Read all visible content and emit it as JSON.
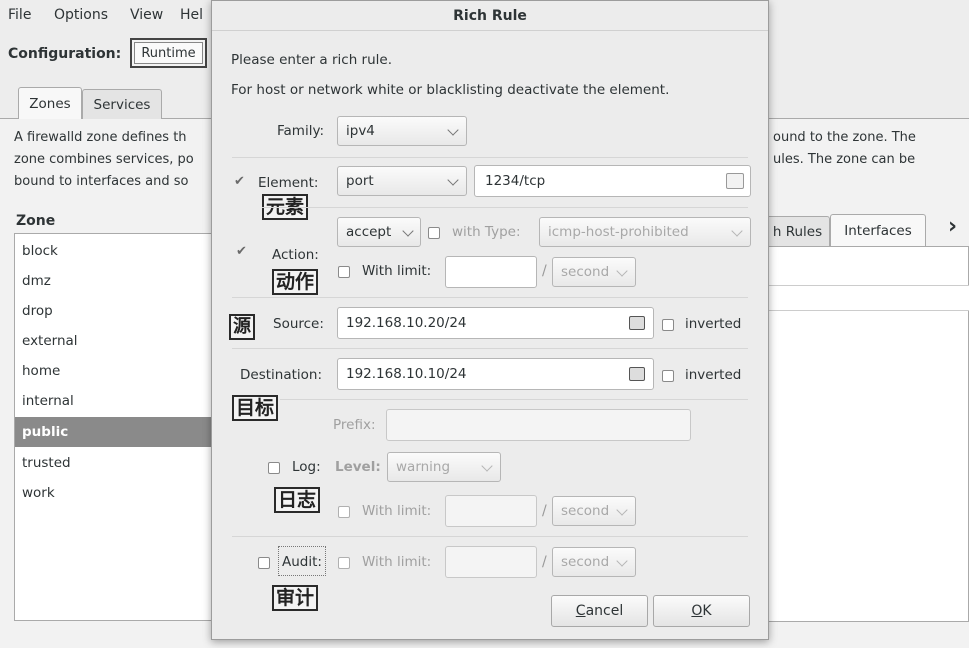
{
  "menu": {
    "file": "File",
    "options": "Options",
    "view": "View",
    "help": "Hel"
  },
  "config": {
    "label": "Configuration:",
    "value": "Runtime"
  },
  "tabs": {
    "zones": "Zones",
    "services": "Services",
    "rich_rules": "h Rules",
    "interfaces": "Interfaces",
    "more": "›"
  },
  "description": {
    "left_line1": "A firewalld zone defines th",
    "left_line2": "zone combines services, po",
    "left_line3": "bound to interfaces and so",
    "right_line1": "ound to the zone. The",
    "right_line2": "ules. The zone can be"
  },
  "zone": {
    "label": "Zone",
    "items": [
      "block",
      "dmz",
      "drop",
      "external",
      "home",
      "internal",
      "public",
      "trusted",
      "work"
    ],
    "selected": "public"
  },
  "dialog": {
    "title": "Rich Rule",
    "intro1": "Please enter a rich rule.",
    "intro2": "For host or network white or blacklisting deactivate the element.",
    "family_label": "Family:",
    "family_value": "ipv4",
    "element_label": "Element:",
    "element_type": "port",
    "element_value": "1234/tcp",
    "action_label": "Action:",
    "action_value": "accept",
    "with_type_label": "with Type:",
    "with_type_value": "icmp-host-prohibited",
    "with_limit_label": "With limit:",
    "limit_unit": "second",
    "slash": "/",
    "source_label": "Source:",
    "source_value": "192.168.10.20/24",
    "inverted_label": "inverted",
    "destination_label": "Destination:",
    "destination_value": "192.168.10.10/24",
    "prefix_label": "Prefix:",
    "log_label": "Log:",
    "level_label": "Level:",
    "level_value": "warning",
    "audit_label": "Audit:",
    "cancel_label_u": "C",
    "cancel_label_rest": "ancel",
    "ok_label_u": "O",
    "ok_label_rest": "K"
  },
  "annotations": {
    "element": "元素",
    "action": "动作",
    "source": "源",
    "destination": "目标",
    "log": "日志",
    "audit": "审计"
  }
}
